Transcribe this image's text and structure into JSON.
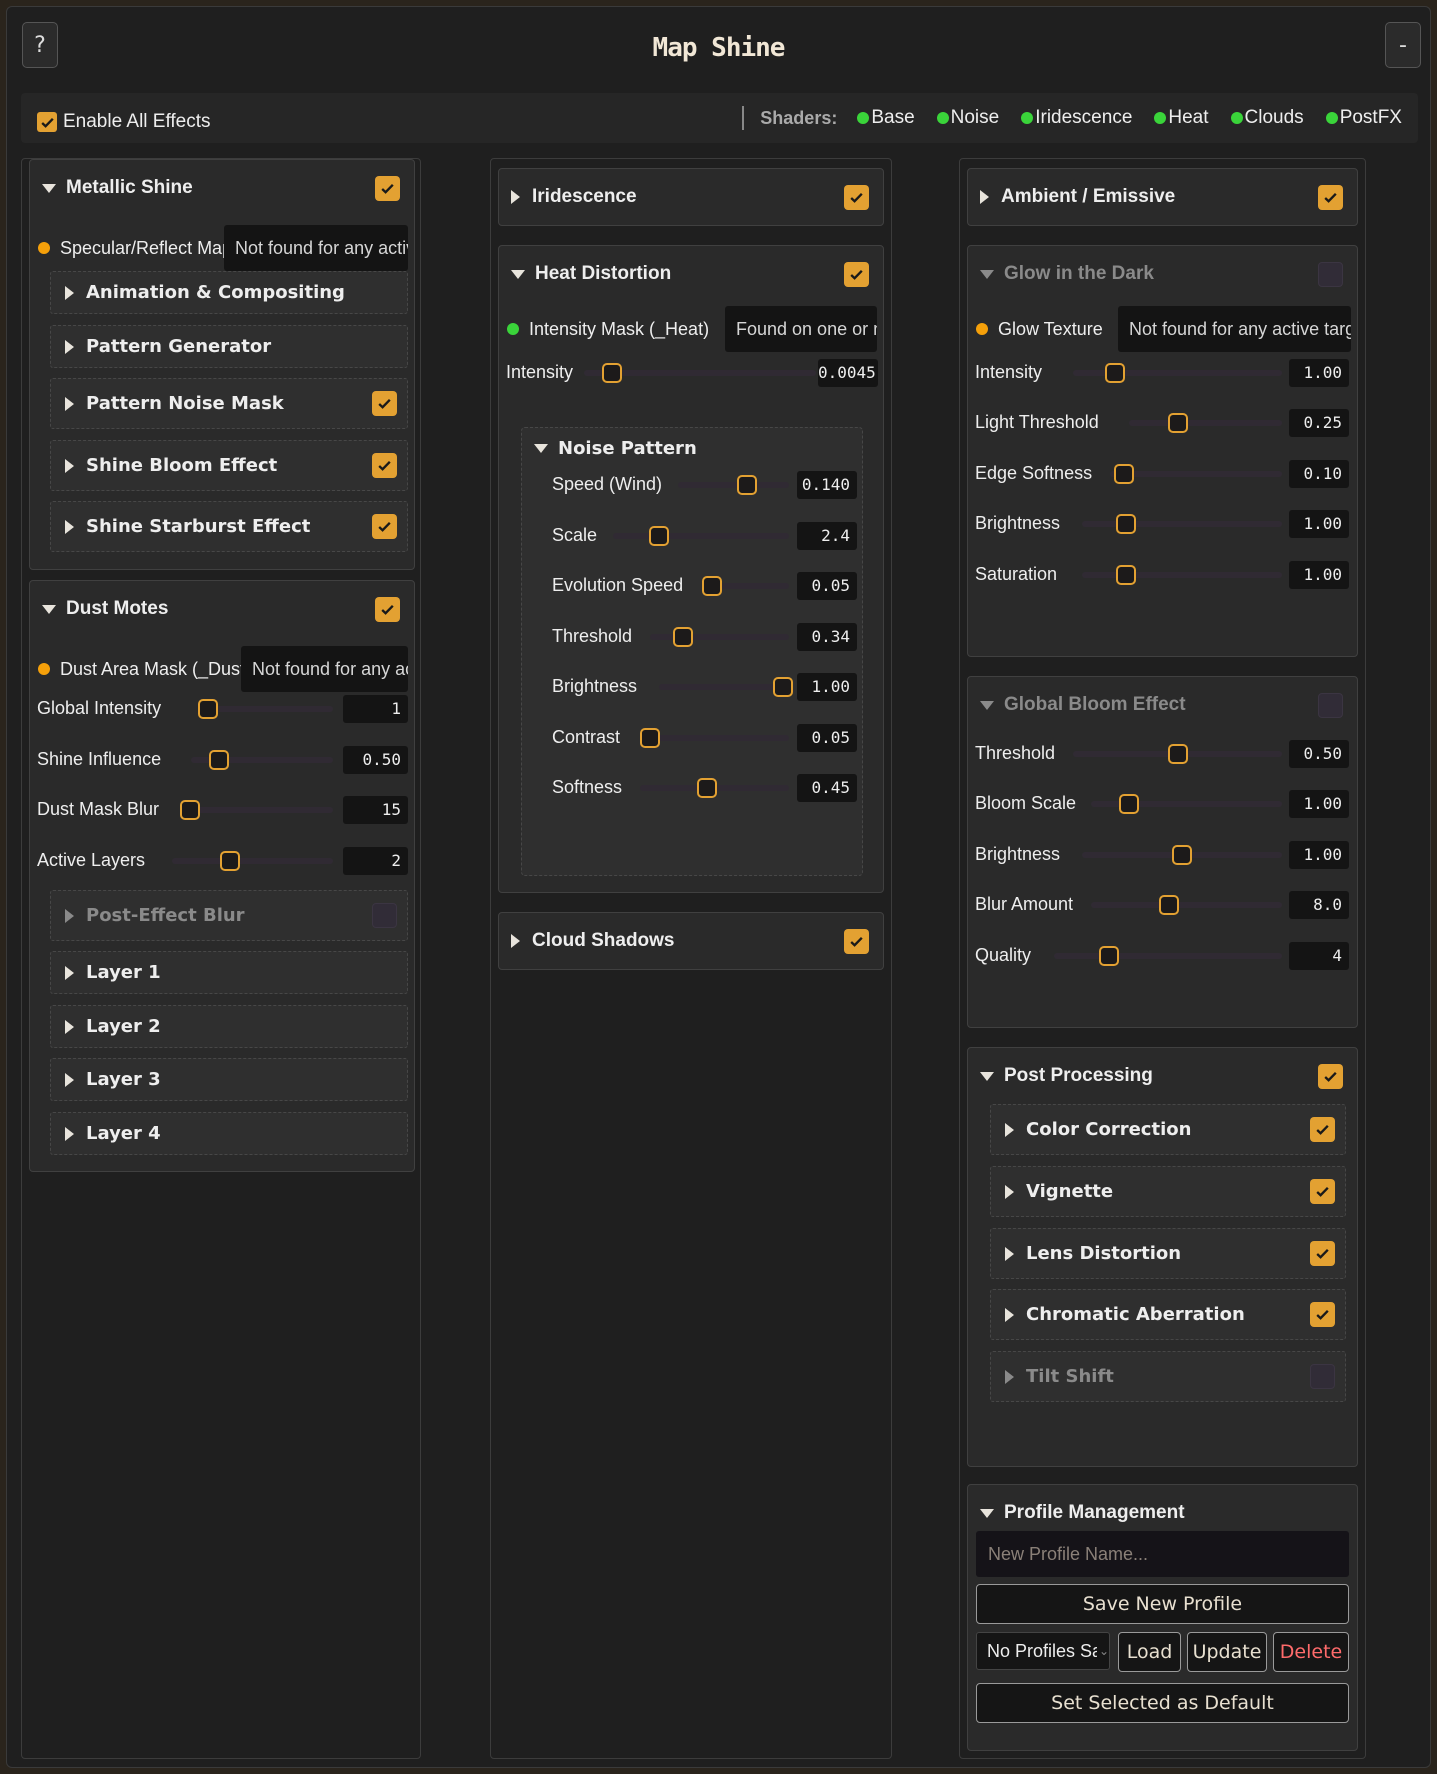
{
  "app": {
    "title": "Map Shine",
    "help_label": "?",
    "minimize_label": "-"
  },
  "topbar": {
    "enable_all_label": "Enable All Effects",
    "shaders_label": "Shaders:",
    "shaders": [
      "Base",
      "Noise",
      "Iridescence",
      "Heat",
      "Clouds",
      "PostFX"
    ]
  },
  "colors": {
    "accent": "#e3a132",
    "ok": "#3ad43a",
    "warn": "#f5a00a"
  },
  "left": {
    "metallic": {
      "title": "Metallic Shine",
      "map_label": "Specular/Reflect Map",
      "map_status": "Not found for any active target.",
      "subs": [
        {
          "label": "Animation & Compositing"
        },
        {
          "label": "Pattern Generator"
        },
        {
          "label": "Pattern Noise Mask"
        },
        {
          "label": "Shine Bloom Effect"
        },
        {
          "label": "Shine Starburst Effect"
        }
      ]
    },
    "dust": {
      "title": "Dust Motes",
      "map_label": "Dust Area Mask (_Dust)",
      "map_status": "Not found for any active target.",
      "sliders": [
        {
          "label": "Global Intensity",
          "value": "1",
          "pos": 0.06
        },
        {
          "label": "Shine Influence",
          "value": "0.50",
          "pos": 0.2
        },
        {
          "label": "Dust Mask Blur",
          "value": "15",
          "pos": 0.06
        },
        {
          "label": "Active Layers",
          "value": "2",
          "pos": 0.36
        }
      ],
      "subs": [
        {
          "label": "Post-Effect Blur"
        },
        {
          "label": "Layer 1"
        },
        {
          "label": "Layer 2"
        },
        {
          "label": "Layer 3"
        },
        {
          "label": "Layer 4"
        }
      ]
    }
  },
  "mid": {
    "iridescence": {
      "title": "Iridescence"
    },
    "heat": {
      "title": "Heat Distortion",
      "map_label": "Intensity Mask (_Heat)",
      "map_status": "Found on one or more targets.",
      "intensity": {
        "label": "Intensity",
        "value": "0.0045",
        "pos": 0.12
      }
    },
    "noise": {
      "title": "Noise Pattern",
      "sliders": [
        {
          "label": "Speed (Wind)",
          "value": "0.140",
          "pos": 0.62
        },
        {
          "label": "Scale",
          "value": "2.4",
          "pos": 0.26
        },
        {
          "label": "Evolution Speed",
          "value": "0.05",
          "pos": 0.07
        },
        {
          "label": "Threshold",
          "value": "0.34",
          "pos": 0.24
        },
        {
          "label": "Brightness",
          "value": "1.00",
          "pos": 0.95
        },
        {
          "label": "Contrast",
          "value": "0.05",
          "pos": 0.07
        },
        {
          "label": "Softness",
          "value": "0.45",
          "pos": 0.45
        }
      ]
    },
    "clouds": {
      "title": "Cloud Shadows"
    }
  },
  "right": {
    "ambient": {
      "title": "Ambient / Emissive"
    },
    "glow": {
      "title": "Glow in the Dark",
      "map_label": "Glow Texture",
      "map_status": "Not found for any active target.",
      "sliders": [
        {
          "label": "Intensity",
          "value": "1.00",
          "pos": 0.2
        },
        {
          "label": "Light Threshold",
          "value": "0.25",
          "pos": 0.32
        },
        {
          "label": "Edge Softness",
          "value": "0.10",
          "pos": 0.08
        },
        {
          "label": "Brightness",
          "value": "1.00",
          "pos": 0.22
        },
        {
          "label": "Saturation",
          "value": "1.00",
          "pos": 0.22
        }
      ]
    },
    "bloom": {
      "title": "Global Bloom Effect",
      "sliders": [
        {
          "label": "Threshold",
          "value": "0.50",
          "pos": 0.5
        },
        {
          "label": "Bloom Scale",
          "value": "1.00",
          "pos": 0.2
        },
        {
          "label": "Brightness",
          "value": "1.00",
          "pos": 0.5
        },
        {
          "label": "Blur Amount",
          "value": "8.0",
          "pos": 0.41
        },
        {
          "label": "Quality",
          "value": "4",
          "pos": 0.24
        }
      ]
    },
    "post": {
      "title": "Post Processing",
      "subs": [
        {
          "label": "Color Correction"
        },
        {
          "label": "Vignette"
        },
        {
          "label": "Lens Distortion"
        },
        {
          "label": "Chromatic Aberration"
        },
        {
          "label": "Tilt Shift"
        }
      ]
    },
    "profile": {
      "title": "Profile Management",
      "name_placeholder": "New Profile Name...",
      "save_label": "Save New Profile",
      "select_value": "No Profiles Saved",
      "load_label": "Load",
      "update_label": "Update",
      "delete_label": "Delete",
      "default_label": "Set Selected as Default"
    }
  }
}
